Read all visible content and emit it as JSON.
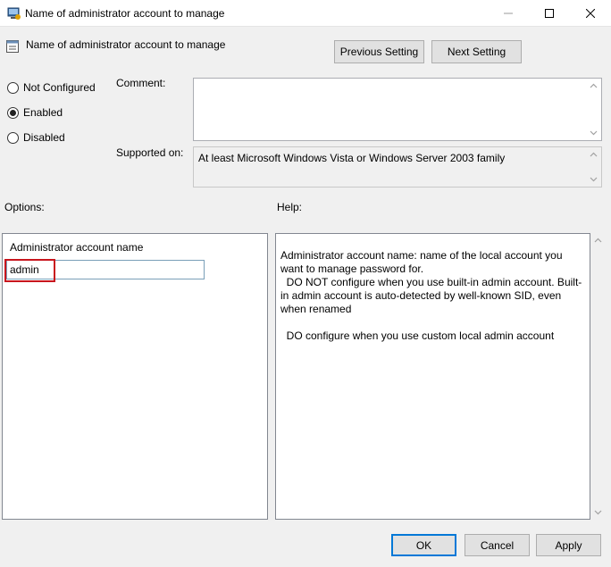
{
  "window": {
    "title": "Name of administrator account to manage",
    "controls": {
      "minimize": "minimize-icon",
      "maximize": "maximize-icon",
      "close": "close-icon"
    }
  },
  "header": {
    "title": "Name of administrator account to manage",
    "icon": "policy-setting-icon"
  },
  "navigation": {
    "previous_label": "Previous Setting",
    "next_label": "Next Setting"
  },
  "state": {
    "options": [
      {
        "label": "Not Configured",
        "selected": false
      },
      {
        "label": "Enabled",
        "selected": true
      },
      {
        "label": "Disabled",
        "selected": false
      }
    ]
  },
  "comment": {
    "label": "Comment:",
    "value": ""
  },
  "supported": {
    "label": "Supported on:",
    "value": "At least Microsoft Windows Vista or Windows Server 2003 family"
  },
  "options_section": {
    "label": "Options:",
    "field_label": "Administrator account name",
    "field_value": "admin"
  },
  "help_section": {
    "label": "Help:",
    "text": "Administrator account name: name of the local account you want to manage password for.\n  DO NOT configure when you use built-in admin account. Built-in admin account is auto-detected by well-known SID, even when renamed\n\n  DO configure when you use custom local admin account"
  },
  "footer": {
    "ok_label": "OK",
    "cancel_label": "Cancel",
    "apply_label": "Apply"
  },
  "colors": {
    "accent": "#0078d7",
    "highlight": "#c8161d",
    "dialog_bg": "#f0f0f0"
  }
}
